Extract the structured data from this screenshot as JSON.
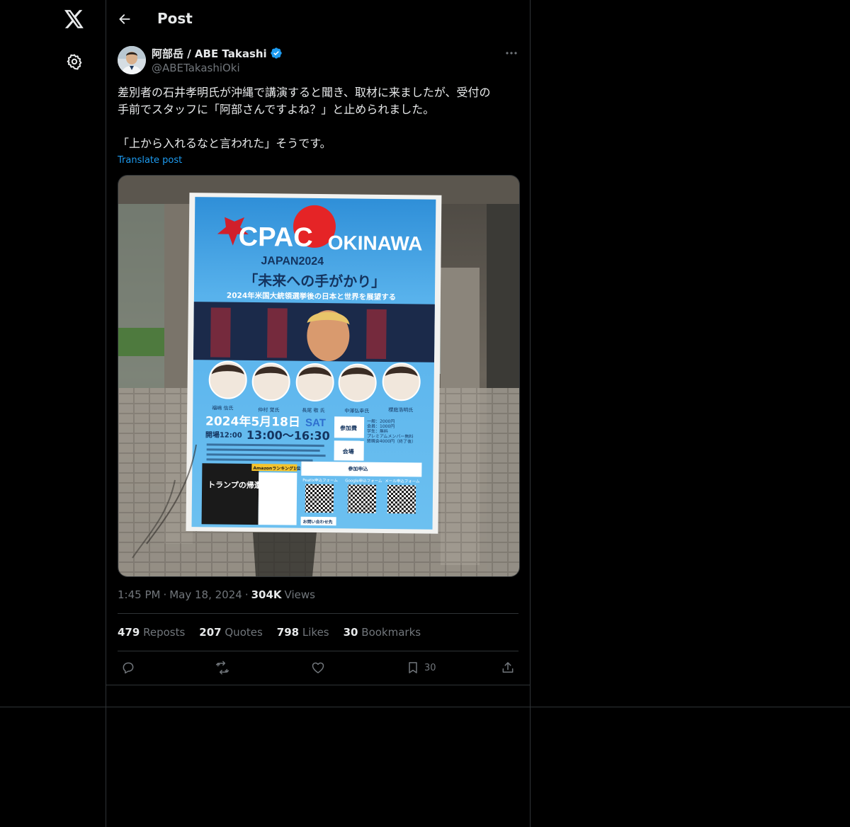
{
  "header": {
    "title": "Post"
  },
  "author": {
    "name": "阿部岳 / ABE Takashi",
    "handle": "@ABETakashiOki"
  },
  "tweet": {
    "lines": [
      "差別者の石井孝明氏が沖縄で講演すると聞き、取材に来ましたが、受付の",
      "手前でスタッフに「阿部さんですよね？」と止められました。",
      "「上から入れるなと言われた」そうです。"
    ],
    "translate_label": "Translate post"
  },
  "media": {
    "poster": {
      "brand": "CPAC",
      "region": "OKINAWA",
      "sub": "JAPAN2024",
      "theme": "「未来への手がかり」",
      "subtitle": "2024年米国大統領選挙後の日本と世界を展望する",
      "date": "2024年5月18日",
      "day": "SAT",
      "open": "開場12:00",
      "time": "13:00〜16:30",
      "fee_label": "参加費",
      "venue_label": "会場",
      "apply_label": "参加申込",
      "book_title": "トランプの帰還",
      "amazon_badge": "Amazonランキング1位",
      "speakers": [
        "福嶋 信氏",
        "仲村 覚氏",
        "長尾 敬 氏",
        "中澤弘幸氏",
        "櫻庭浩明氏"
      ],
      "fees": [
        "一般：2000円",
        "会員：1000円",
        "学生：無料",
        "プレミアムメンバー無料",
        "懇親会4000円（終了後）"
      ],
      "qr_labels": [
        "Peatix申込フォーム",
        "Google申込フォーム",
        "メール申込フォーム"
      ],
      "contact": "お問い合わせ先"
    }
  },
  "meta": {
    "time": "1:45 PM",
    "date": "May 18, 2024",
    "views_count": "304K",
    "views_label": "Views"
  },
  "stats": [
    {
      "count": "479",
      "label": "Reposts"
    },
    {
      "count": "207",
      "label": "Quotes"
    },
    {
      "count": "798",
      "label": "Likes"
    },
    {
      "count": "30",
      "label": "Bookmarks"
    }
  ],
  "actions": {
    "bookmark_count": "30"
  },
  "colors": {
    "accent": "#1d9bf0",
    "muted": "#71767b",
    "text": "#e7e9ea",
    "border": "#2f3336"
  },
  "icons": [
    "x-logo-icon",
    "gear-icon",
    "back-arrow-icon",
    "verified-badge-icon",
    "more-icon",
    "reply-icon",
    "repost-icon",
    "like-icon",
    "bookmark-icon",
    "share-icon"
  ]
}
